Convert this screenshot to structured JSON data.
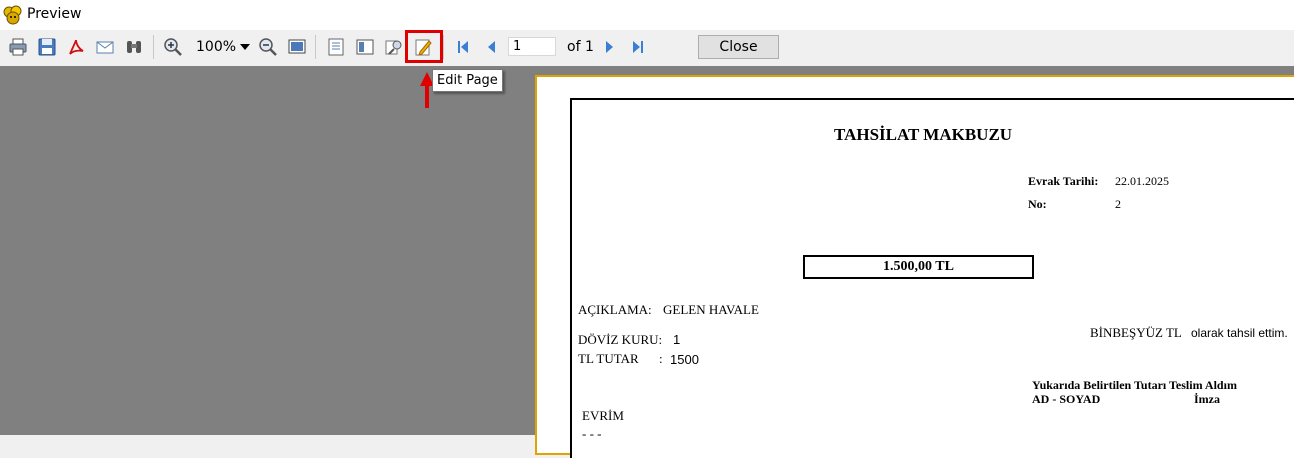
{
  "window": {
    "title": "Preview"
  },
  "toolbar": {
    "zoom_value": "100%",
    "page_number": "1",
    "page_of": "of 1",
    "close_label": "Close",
    "tooltip": "Edit Page"
  },
  "icons": [
    "app-icon",
    "print-icon",
    "save-icon",
    "pdf-icon",
    "email-icon",
    "find-icon",
    "zoom-in-icon",
    "zoom-out-icon",
    "full-screen-icon",
    "outline-icon",
    "thumbnail-icon",
    "design-icon",
    "edit-page-icon",
    "first-page-icon",
    "previous-page-icon",
    "next-page-icon",
    "last-page-icon"
  ],
  "colors": {
    "highlight": "#e00000",
    "page_border": "#e0a400",
    "workspace": "#808080",
    "nav_icon": "#3b7fd4"
  },
  "document": {
    "title": "TAHSİLAT MAKBUZU",
    "date_label": "Evrak Tarihi:",
    "date_value": "22.01.2025",
    "no_label": "No:",
    "no_value": "2",
    "amount": "1.500,00 TL",
    "description_label": "AÇIKLAMA:",
    "description_value": "GELEN HAVALE",
    "amount_words": "BİNBEŞYÜZ TL",
    "received_text": "olarak tahsil ettim.",
    "rate_label": "DÖVİZ KURU:",
    "rate_value": "1",
    "tl_label": "TL TUTAR",
    "tl_colon": ":",
    "tl_value": "1500",
    "receipt_text": "Yukarıda Belirtilen Tutarı Teslim Aldım",
    "name_label": "AD - SOYAD",
    "signature_label": "İmza",
    "company": "EVRİM",
    "partial_line": "- - -"
  }
}
